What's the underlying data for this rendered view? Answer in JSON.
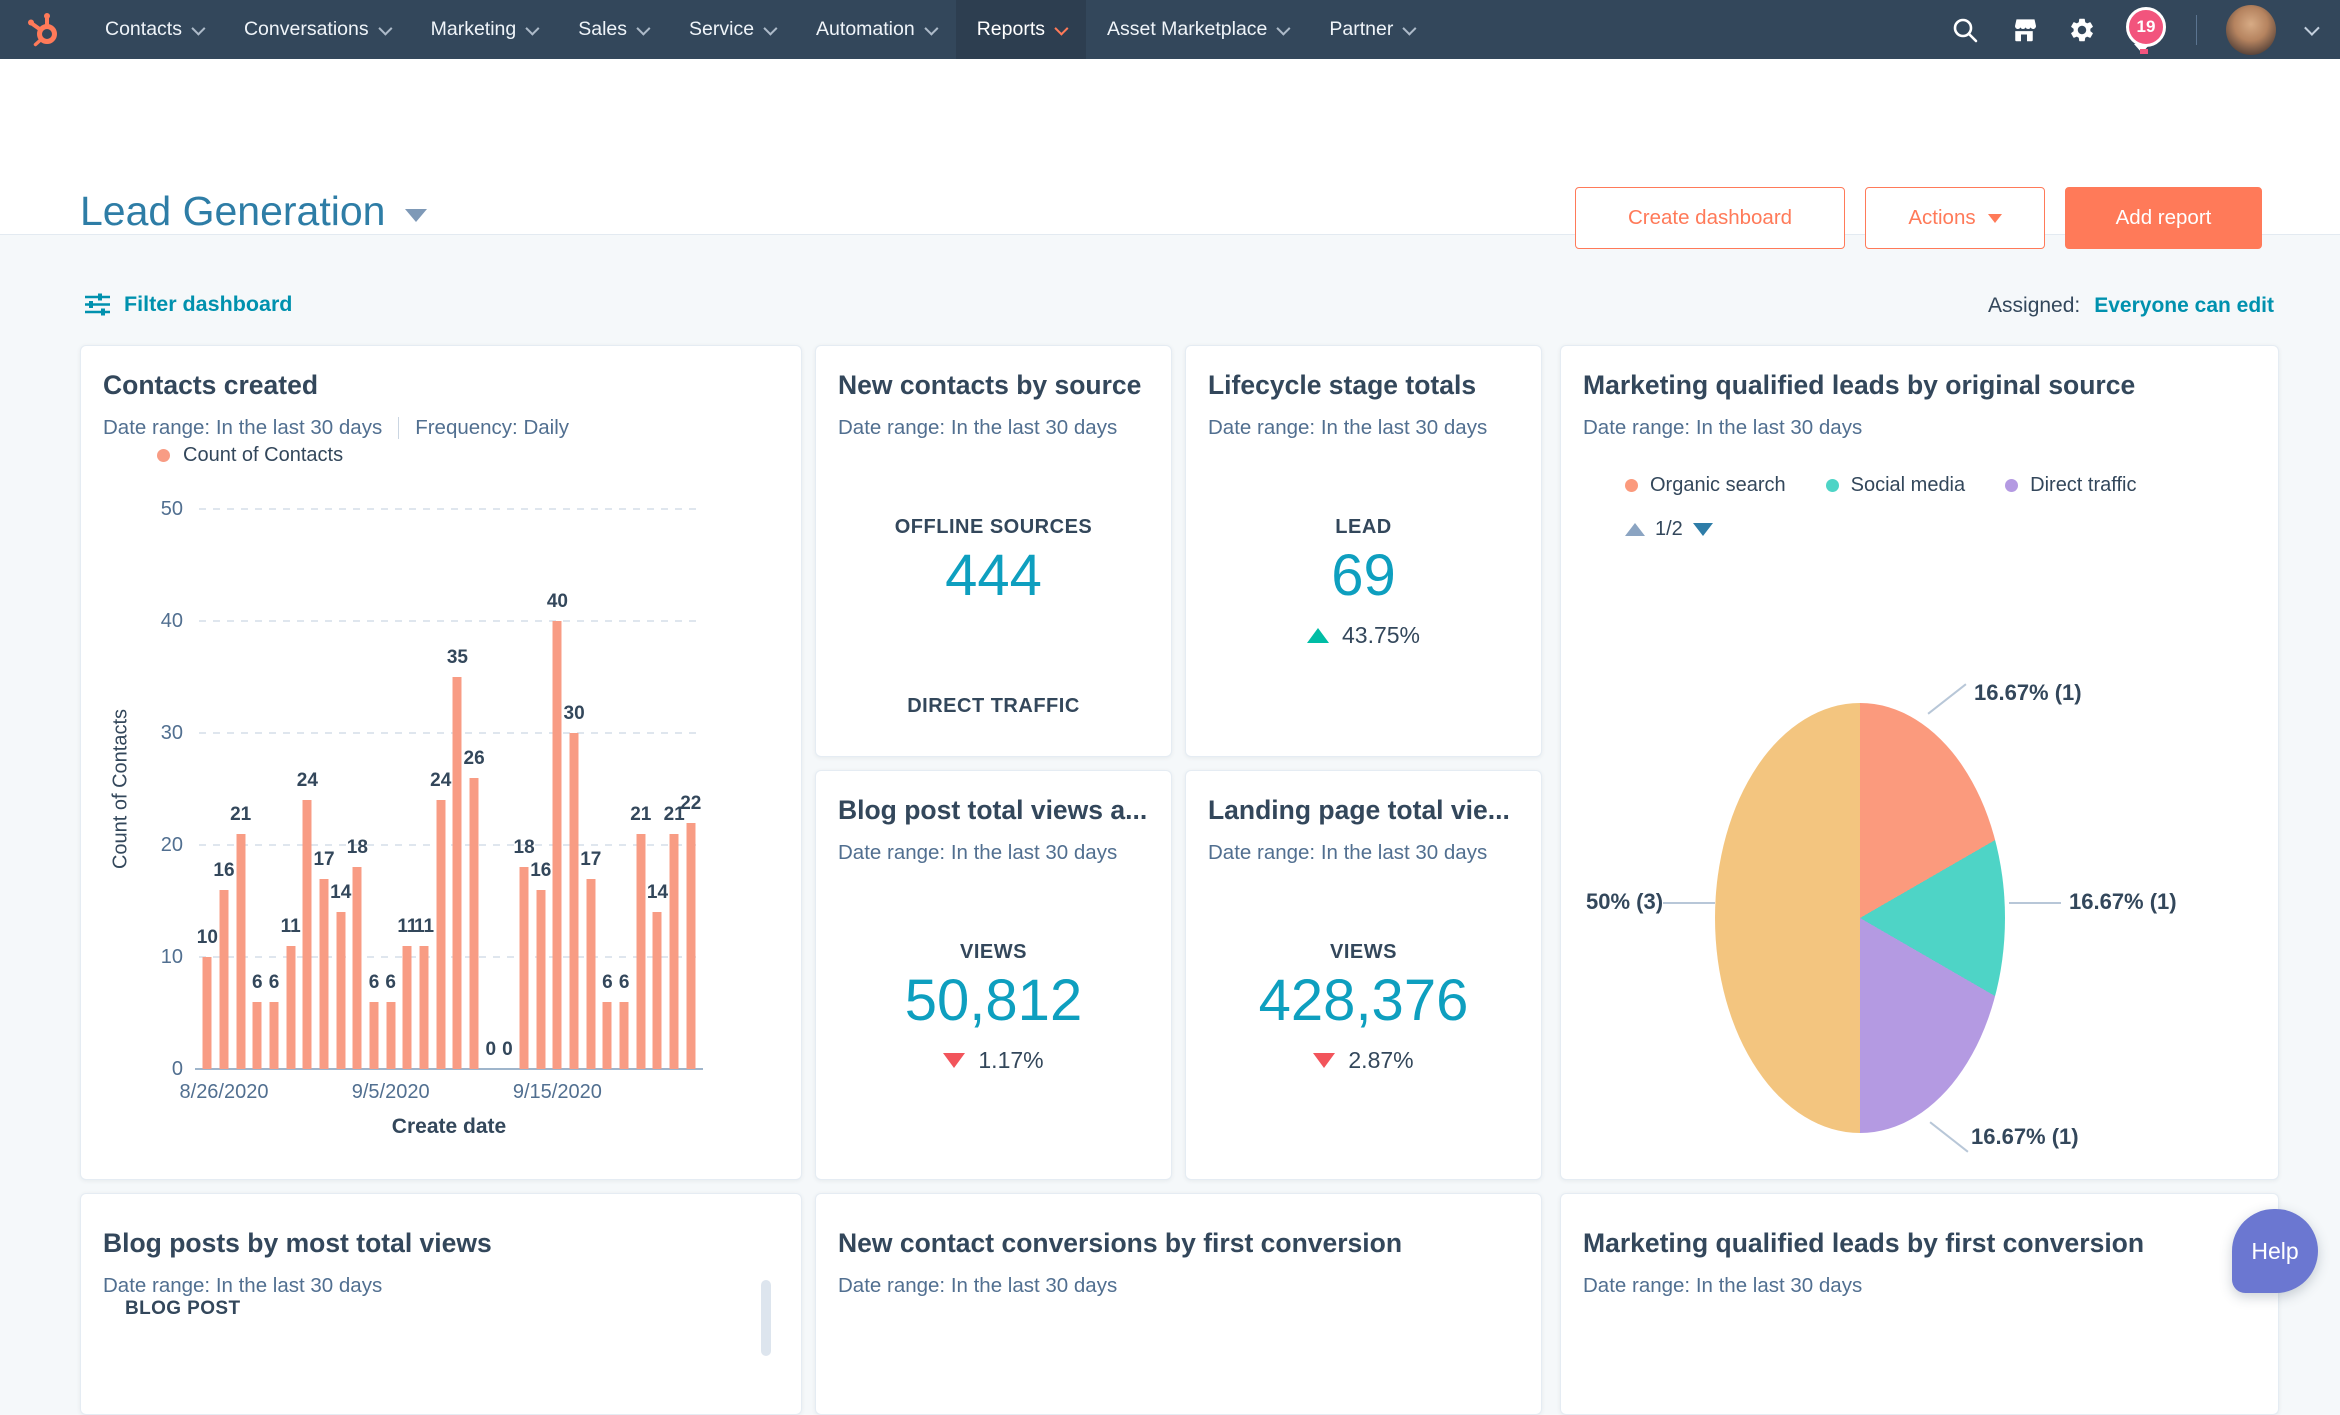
{
  "nav": {
    "logo_icon": "hubspot-sprocket",
    "items": [
      {
        "label": "Contacts"
      },
      {
        "label": "Conversations"
      },
      {
        "label": "Marketing"
      },
      {
        "label": "Sales"
      },
      {
        "label": "Service"
      },
      {
        "label": "Automation"
      },
      {
        "label": "Reports",
        "active": true
      },
      {
        "label": "Asset Marketplace"
      },
      {
        "label": "Partner"
      }
    ],
    "icons": {
      "search": "magnifier",
      "marketplace": "storefront",
      "settings": "gear",
      "notifications": "balloon-with-badge",
      "account": "avatar",
      "account_menu": "chevron-down"
    },
    "notification_count": "19"
  },
  "header": {
    "title": "Lead Generation",
    "buttons": {
      "create_dashboard": "Create dashboard",
      "actions": "Actions",
      "add_report": "Add report"
    }
  },
  "filter_bar": {
    "filter_label": "Filter dashboard",
    "assigned_label": "Assigned:",
    "assigned_value": "Everyone can edit"
  },
  "cards": {
    "contacts_created": {
      "title": "Contacts created",
      "date_range": "Date range: In the last 30 days",
      "frequency": "Frequency: Daily",
      "legend_label": "Count of Contacts",
      "chart_data": {
        "type": "bar",
        "series_name": "Count of Contacts",
        "values": [
          10,
          16,
          21,
          6,
          6,
          11,
          24,
          17,
          14,
          18,
          6,
          6,
          11,
          11,
          24,
          35,
          26,
          0,
          0,
          18,
          16,
          40,
          30,
          17,
          6,
          6,
          21,
          14,
          21,
          22
        ],
        "y_ticks": [
          0,
          10,
          20,
          30,
          40,
          50
        ],
        "ylim": [
          0,
          50
        ],
        "x_ticks": [
          {
            "index": 1,
            "label": "8/26/2020"
          },
          {
            "index": 11,
            "label": "9/5/2020"
          },
          {
            "index": 21,
            "label": "9/15/2020"
          }
        ],
        "xlabel": "Create date",
        "ylabel": "Count of Contacts",
        "bar_color": "#f89c84",
        "grid": "dashed-horizontal"
      }
    },
    "new_contacts_by_source": {
      "title": "New contacts by source",
      "date_range": "Date range: In the last 30 days",
      "metric_label": "OFFLINE SOURCES",
      "metric_value": "444",
      "next_label": "DIRECT TRAFFIC"
    },
    "lifecycle_stage_totals": {
      "title": "Lifecycle stage totals",
      "date_range": "Date range: In the last 30 days",
      "metric_label": "LEAD",
      "metric_value": "69",
      "delta": {
        "value": "43.75%",
        "direction": "up"
      }
    },
    "mql_original_source": {
      "title": "Marketing qualified leads by original source",
      "date_range": "Date range: In the last 30 days",
      "pagination": "1/2",
      "chart_data": {
        "type": "pie",
        "slices": [
          {
            "label": "Organic search",
            "percent": 16.67,
            "count": 1,
            "display": "16.67% (1)",
            "color": "#fb9a7d"
          },
          {
            "label": "Social media",
            "percent": 16.67,
            "count": 1,
            "display": "16.67% (1)",
            "color": "#4ed4c6"
          },
          {
            "label": "Direct traffic",
            "percent": 16.67,
            "count": 1,
            "display": "16.67% (1)",
            "color": "#b49ae2"
          },
          {
            "label": "",
            "percent": 50,
            "count": 3,
            "display": "50% (3)",
            "color": "#f3c57f"
          }
        ],
        "legend_position": "top"
      }
    },
    "blog_post_views": {
      "title": "Blog post total views a...",
      "date_range": "Date range: In the last 30 days",
      "metric_label": "VIEWS",
      "metric_value": "50,812",
      "delta": {
        "value": "1.17%",
        "direction": "down"
      }
    },
    "landing_page_views": {
      "title": "Landing page total vie...",
      "date_range": "Date range: In the last 30 days",
      "metric_label": "VIEWS",
      "metric_value": "428,376",
      "delta": {
        "value": "2.87%",
        "direction": "down"
      }
    },
    "blog_posts_by_views": {
      "title": "Blog posts by most total views",
      "date_range": "Date range: In the last 30 days",
      "column_header": "BLOG POST"
    },
    "contact_conversions": {
      "title": "New contact conversions by first conversion",
      "date_range": "Date range: In the last 30 days"
    },
    "mql_first_conversion": {
      "title": "Marketing qualified leads by first conversion",
      "date_range": "Date range: In the last 30 days"
    }
  },
  "help_button": {
    "label": "Help"
  },
  "colors": {
    "nav_bg": "#33475b",
    "nav_active_bg": "#2d3e50",
    "accent_orange": "#ff7a59",
    "title_blue": "#2e7da6",
    "link_teal": "#0091ae",
    "meta": "#516f90",
    "kpi_teal": "#0e9fbf",
    "bar": "#f89c84",
    "up_green": "#00bda5",
    "down_red": "#f2545b",
    "badge_pink": "#f2547d",
    "help_purple": "#6b77d1",
    "page_bg": "#f5f8fa",
    "card_border": "#e5ecf3",
    "grid_line": "#dfe6ee",
    "axis_line": "#9fb5cb",
    "pager_inactive": "#8ba4c2",
    "pager_active": "#2e7da8"
  }
}
